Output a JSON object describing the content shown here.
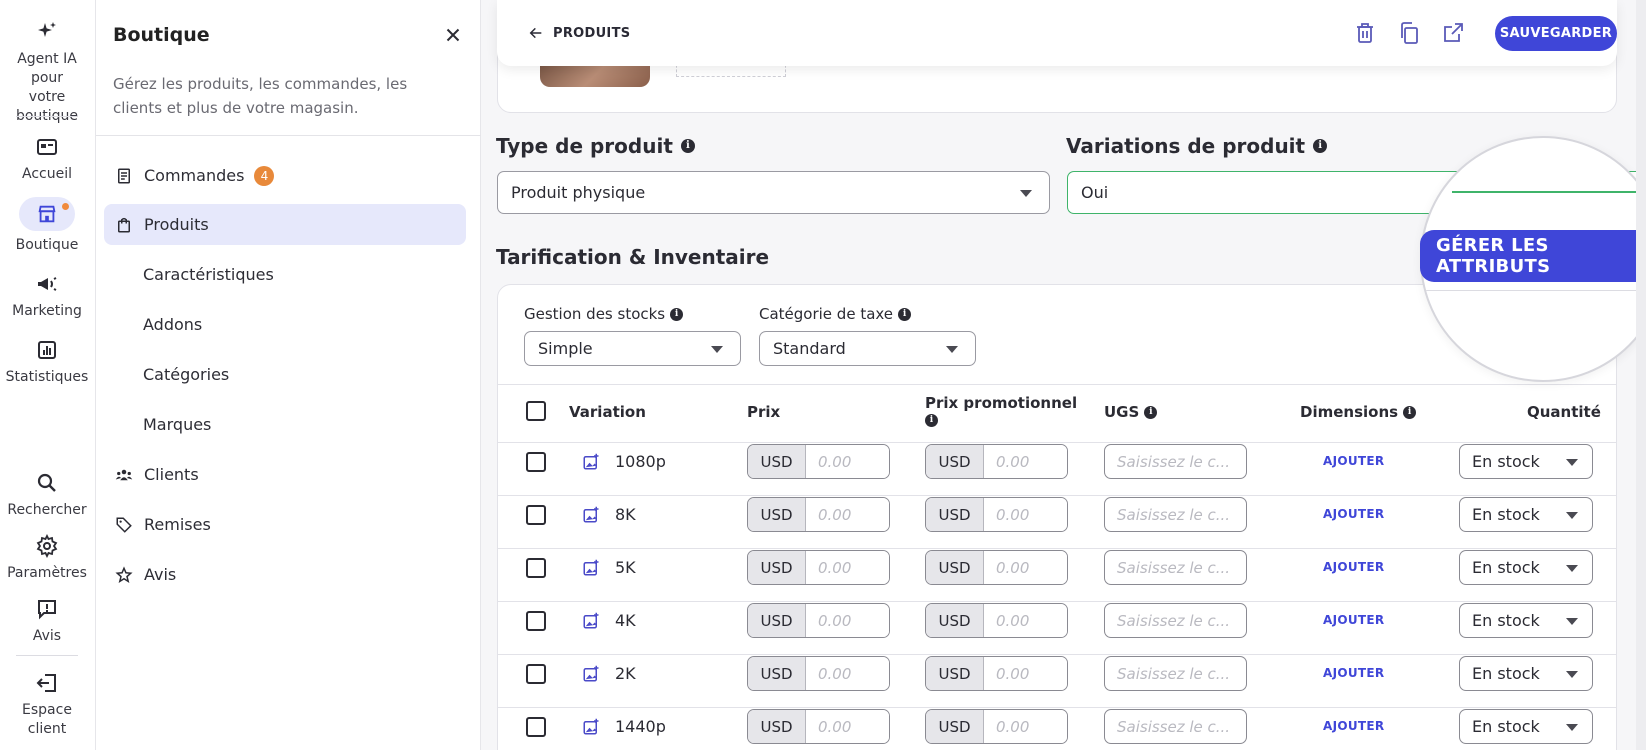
{
  "rail": {
    "items": [
      {
        "label": "Agent IA pour votre boutique",
        "icon": "sparkles-icon"
      },
      {
        "label": "Accueil",
        "icon": "home-icon"
      },
      {
        "label": "Boutique",
        "icon": "store-icon"
      },
      {
        "label": "Marketing",
        "icon": "megaphone-icon"
      },
      {
        "label": "Statistiques",
        "icon": "chart-icon"
      },
      {
        "label": "Rechercher",
        "icon": "search-icon"
      },
      {
        "label": "Paramètres",
        "icon": "gear-icon"
      },
      {
        "label": "Avis",
        "icon": "feedback-icon"
      },
      {
        "label": "Espace client",
        "icon": "logout-icon"
      }
    ]
  },
  "panel": {
    "title": "Boutique",
    "description": "Gérez les produits, les commandes, les clients et plus de votre magasin.",
    "nav": [
      {
        "label": "Commandes",
        "badge": "4",
        "icon": "receipt-icon"
      },
      {
        "label": "Produits",
        "icon": "bag-icon"
      },
      {
        "label": "Caractéristiques"
      },
      {
        "label": "Addons"
      },
      {
        "label": "Catégories"
      },
      {
        "label": "Marques"
      },
      {
        "label": "Clients",
        "icon": "users-icon"
      },
      {
        "label": "Remises",
        "icon": "tag-icon"
      },
      {
        "label": "Avis",
        "icon": "star-icon"
      }
    ]
  },
  "toolbar": {
    "back_label": "PRODUITS",
    "save_label": "SAUVEGARDER",
    "icons": [
      "trash-icon",
      "copy-icon",
      "external-link-icon"
    ]
  },
  "product_type": {
    "title": "Type de produit",
    "value": "Produit physique"
  },
  "variations": {
    "title": "Variations de produit",
    "value": "Oui",
    "manage_label": "GÉRER LES ATTRIBUTS"
  },
  "pricing": {
    "title": "Tarification & Inventaire",
    "stock_label": "Gestion des stocks",
    "stock_value": "Simple",
    "tax_label": "Catégorie de taxe",
    "tax_value": "Standard"
  },
  "table": {
    "headers": {
      "variation": "Variation",
      "price": "Prix",
      "promo": "Prix promotionnel",
      "sku": "UGS",
      "dimensions": "Dimensions",
      "quantity": "Quantité"
    },
    "currency": "USD",
    "price_placeholder": "0.00",
    "sku_placeholder": "Saisissez le c...",
    "add_label": "AJOUTER",
    "rows": [
      {
        "name": "1080p",
        "stock": "En stock"
      },
      {
        "name": "8K",
        "stock": "En stock"
      },
      {
        "name": "5K",
        "stock": "En stock"
      },
      {
        "name": "4K",
        "stock": "En stock"
      },
      {
        "name": "2K",
        "stock": "En stock"
      },
      {
        "name": "1440p",
        "stock": "En stock"
      }
    ]
  },
  "colors": {
    "accent": "#3f46d8",
    "badge": "#e8893a",
    "success_border": "#3fb46a",
    "active_nav": "#e6e8fb"
  }
}
